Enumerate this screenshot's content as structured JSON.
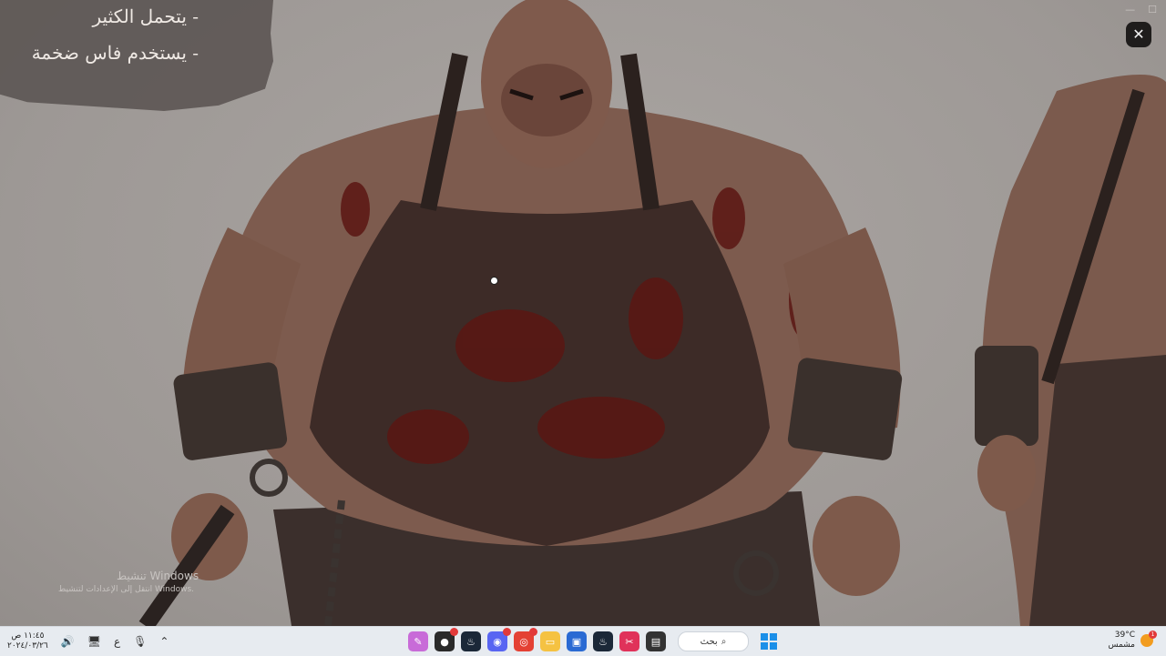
{
  "notes": {
    "line1": "- يتحمل الكثير",
    "line2": "- يستخدم فاس ضخمة"
  },
  "viewer": {
    "close_icon": "close-icon",
    "close_glyph": "✕",
    "minimize_glyph": "—",
    "maximize_glyph": "☐",
    "watermark_title": "تنشيط Windows",
    "watermark_sub": "انتقل إلى الإعدادات لتنشيط Windows."
  },
  "taskbar": {
    "time": "١١:٤٥ ص",
    "date": "٢٠٢٤/٠٣/٢٦",
    "lang": "ع",
    "search_label": "بحث",
    "weather_temp": "39°C",
    "weather_desc": "مشمس",
    "weather_badge": "1",
    "apps": [
      {
        "name": "paint-app-icon",
        "color": "#c86bd8"
      },
      {
        "name": "media-app-icon",
        "color": "#2a2a2a"
      },
      {
        "name": "steam-icon",
        "color": "#1b2838"
      },
      {
        "name": "discord-icon",
        "color": "#5865f2"
      },
      {
        "name": "chrome-icon",
        "color": "#e44134"
      },
      {
        "name": "file-explorer-icon",
        "color": "#f5c242"
      },
      {
        "name": "store-icon",
        "color": "#2a6ad3"
      },
      {
        "name": "steam-icon-2",
        "color": "#1b2838"
      },
      {
        "name": "snipping-tool-icon",
        "color": "#e0325a"
      },
      {
        "name": "task-view-icon",
        "color": "#333333"
      }
    ]
  },
  "colors": {
    "accent": "#1b8fe8",
    "taskbar_bg": "#e7ebf0"
  }
}
